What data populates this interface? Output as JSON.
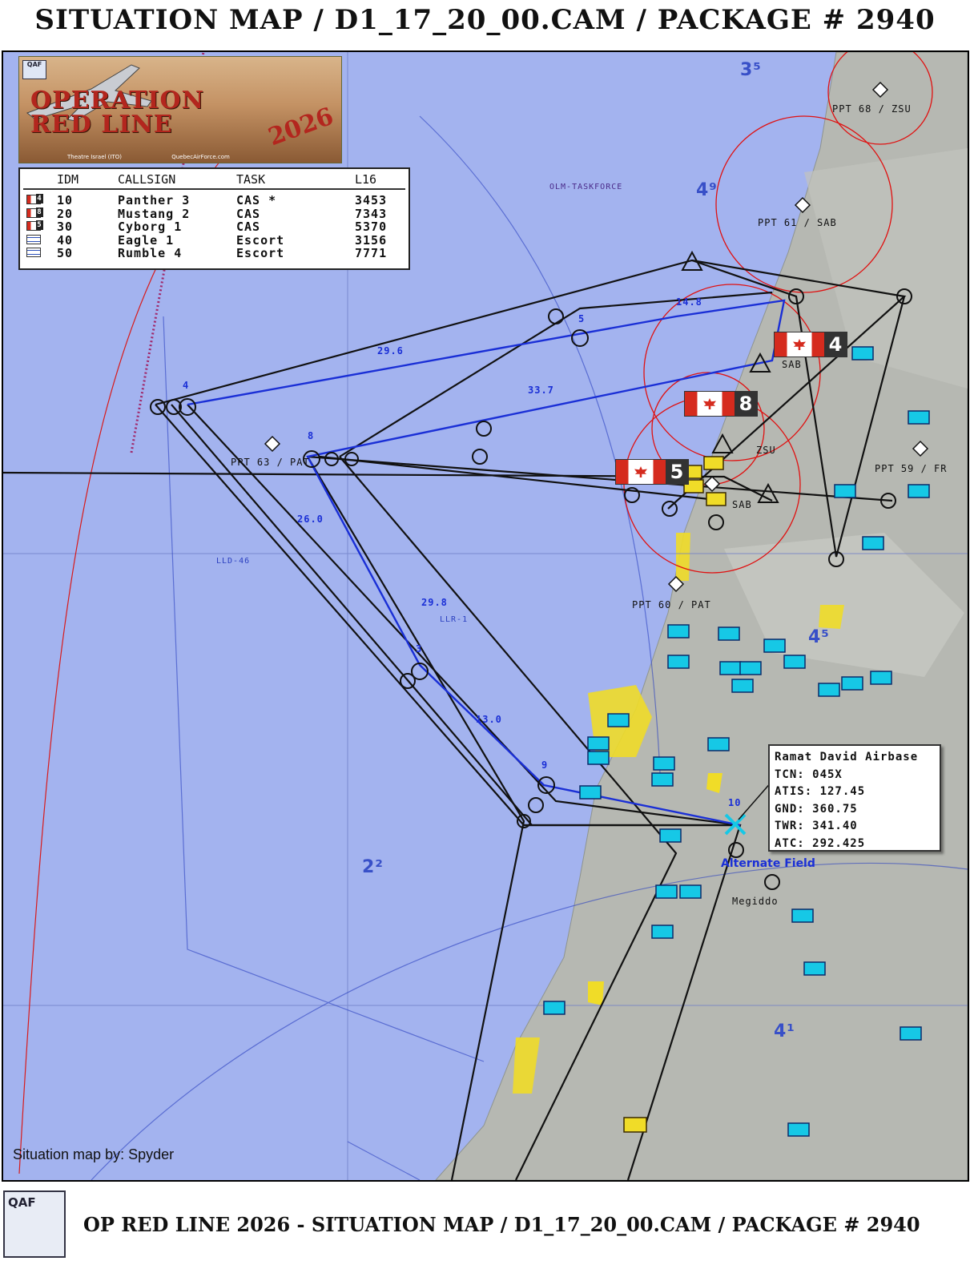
{
  "title": "SITUATION MAP / D1_17_20_00.CAM / PACKAGE # 2940",
  "logo": {
    "brand": "QAF",
    "line1": "OPERATION",
    "line2": "RED LINE",
    "year": "2026",
    "theatre": "Theatre Israel (ITO)",
    "site": "QuebecAirForce.com"
  },
  "flight_table": {
    "headers": {
      "idm": "IDM",
      "callsign": "CALLSIGN",
      "task": "TASK",
      "l16": "L16"
    },
    "rows": [
      {
        "flag": "ca",
        "flight": "4",
        "idm": "10",
        "callsign": "Panther 3",
        "task": "CAS *",
        "l16": "3453"
      },
      {
        "flag": "ca",
        "flight": "8",
        "idm": "20",
        "callsign": "Mustang 2",
        "task": "CAS",
        "l16": "7343"
      },
      {
        "flag": "ca",
        "flight": "5",
        "idm": "30",
        "callsign": "Cyborg 1",
        "task": "CAS",
        "l16": "5370"
      },
      {
        "flag": "il",
        "flight": "",
        "idm": "40",
        "callsign": "Eagle 1",
        "task": "Escort",
        "l16": "3156"
      },
      {
        "flag": "il",
        "flight": "",
        "idm": "50",
        "callsign": "Rumble 4",
        "task": "Escort",
        "l16": "7771"
      }
    ]
  },
  "airbase_info": {
    "name": "Ramat David Airbase",
    "tcn": "TCN: 045X",
    "atis": "ATIS: 127.45",
    "gnd": "GND: 360.75",
    "twr": "TWR: 341.40",
    "atc": "ATC: 292.425"
  },
  "flight_markers": {
    "m1": "4",
    "m2": "8",
    "m3": "5"
  },
  "map_labels": {
    "ppt68": "PPT 68 / ZSU",
    "ppt61": "PPT 61 / SAB",
    "ppt63": "PPT 63 / PAT",
    "ppt59": "PPT 59 / FR",
    "ppt60": "PPT 60 / PAT",
    "sab": "SAB",
    "zsu": "ZSU",
    "olm": "OLM-TASKFORCE",
    "alternate": "Alternate Field",
    "megiddo": "Megiddo",
    "lld46": "LLD-46",
    "llr1": "LLR-1",
    "sector35": "3⁵",
    "sector49": "4⁹",
    "sector45": "4⁵",
    "sector22": "2²",
    "sector41": "4¹"
  },
  "waypoints": {
    "w3": "3",
    "w4": "4",
    "w5": "5",
    "w8": "8",
    "w9": "9",
    "w10": "10"
  },
  "legs": {
    "l1": "14.8",
    "l2": "29.6",
    "l3": "33.7",
    "l4": "26.0",
    "l5": "29.8",
    "l6": "13.0"
  },
  "credit": "Situation map  by: Spyder",
  "footer": {
    "brand": "QAF",
    "text": "OP RED LINE 2026 - SITUATION MAP / D1_17_20_00.CAM / PACKAGE # 2940"
  },
  "colors": {
    "sea": "#a3b3ef",
    "route_blue": "#1a2fd6",
    "threat_red": "#e01010",
    "friendly_cyan": "#16c8e6"
  }
}
